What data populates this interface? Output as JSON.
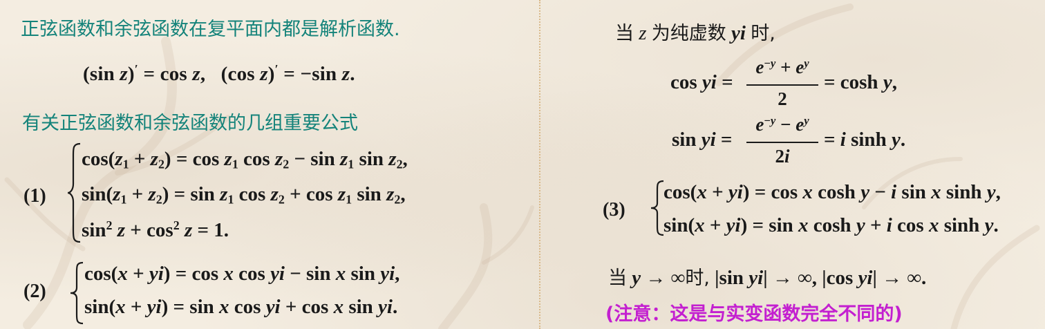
{
  "left": {
    "heading1": "正弦函数和余弦函数在复平面内都是解析函数.",
    "derivatives": "(sin z)′ = cos z,   (cos z)′ = −sin z.",
    "heading2": "有关正弦函数和余弦函数的几组重要公式",
    "group1_label": "(1)",
    "group1": [
      "cos(z₁ + z₂) = cos z₁ cos z₂ − sin z₁ sin z₂,",
      "sin(z₁ + z₂) = sin z₁ cos z₂ + cos z₁ sin z₂,",
      "sin² z + cos² z = 1."
    ],
    "group2_label": "(2)",
    "group2": [
      "cos(x + yi) = cos x cos yi − sin x sin yi,",
      "sin(x + yi) = sin x cos yi + cos x sin yi."
    ]
  },
  "right": {
    "intro": "当 z 为纯虚数 yi 时,",
    "cos_yi": {
      "lhs": "cos yi =",
      "numerator": "e⁻ʸ + eʸ",
      "denominator": "2",
      "rhs": "= cosh y,"
    },
    "sin_yi": {
      "lhs": "sin yi =",
      "numerator": "e⁻ʸ − eʸ",
      "denominator": "2i",
      "rhs": "= i sinh y."
    },
    "group3_label": "(3)",
    "group3": [
      "cos(x + yi) = cos x cosh y − i sin x sinh y,",
      "sin(x + yi) = sin x cosh y + i cos x sinh y."
    ],
    "limit_line": "当 y → ∞时, |sin yi| → ∞, |cos yi| → ∞.",
    "note": "(注意：这是与实变函数完全不同的)"
  },
  "colors": {
    "teal": "#14837a",
    "magenta": "#c31fd0",
    "divider": "#d9b98a",
    "background": "#f4ede1"
  }
}
